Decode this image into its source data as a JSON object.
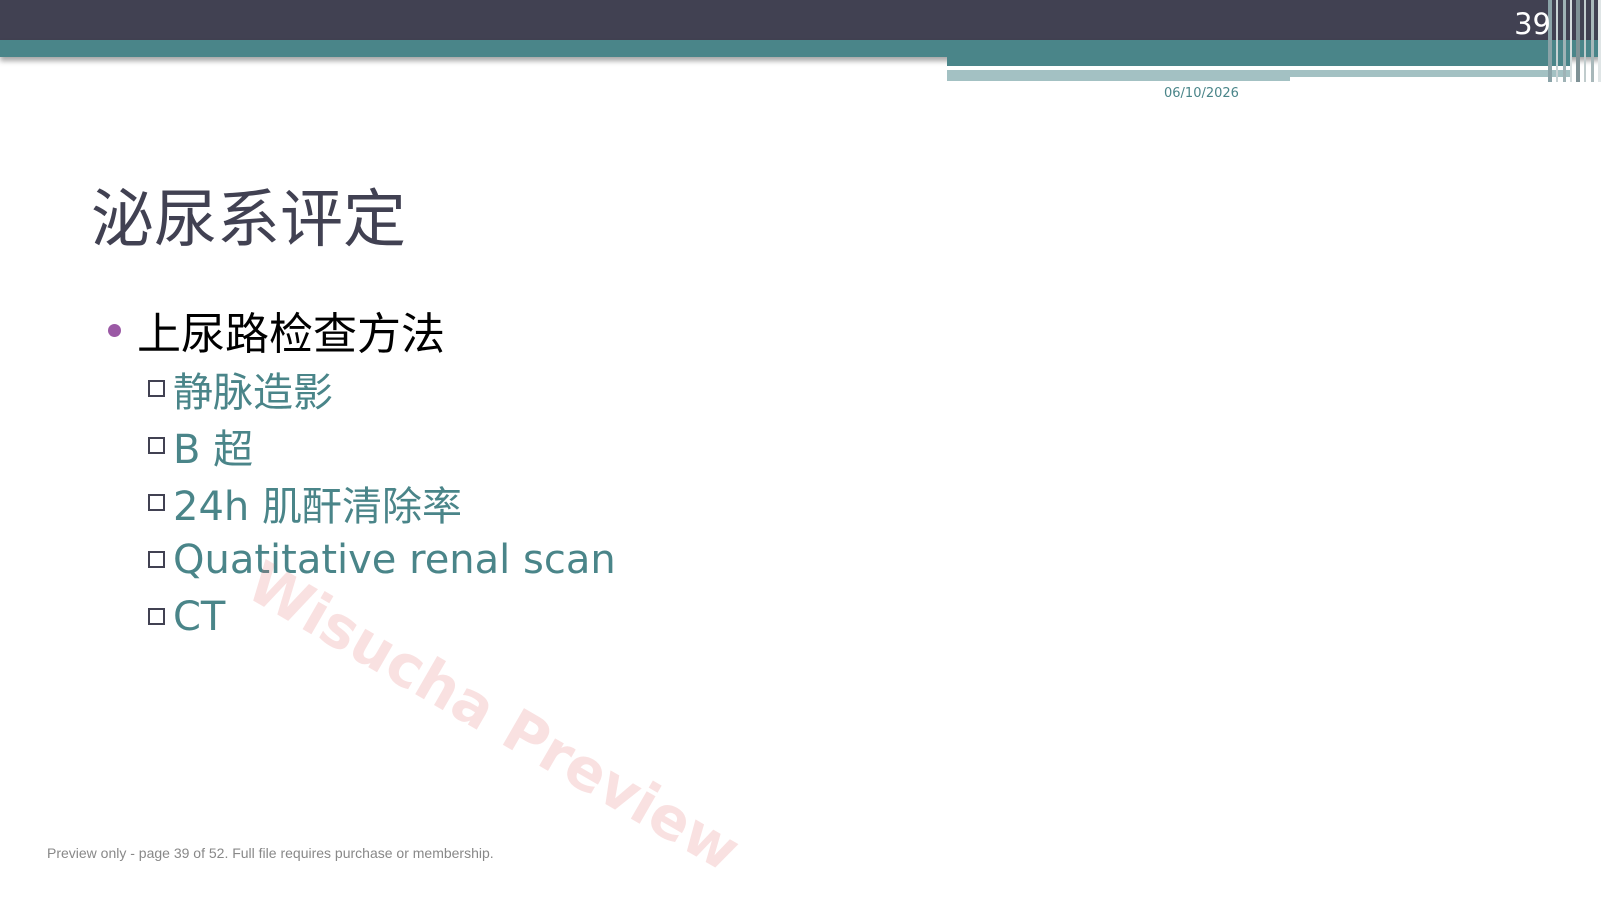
{
  "header": {
    "page_number": "39",
    "date": "06/10/2026"
  },
  "slide": {
    "title": "泌尿系评定",
    "bullet": "上尿路检查方法",
    "sub_items": [
      "静脉造影",
      "B 超",
      "24h 肌酐清除率",
      "Quatitative renal scan",
      "CT"
    ]
  },
  "watermark": "Wisucha Preview",
  "footer": {
    "notice": "Preview only - page 39 of 52. Full file requires purchase or membership."
  },
  "colors": {
    "header_dark": "#414152",
    "accent_teal": "#4a8589",
    "accent_light": "#a3c1c3",
    "bullet_purple": "#9b59a5"
  }
}
